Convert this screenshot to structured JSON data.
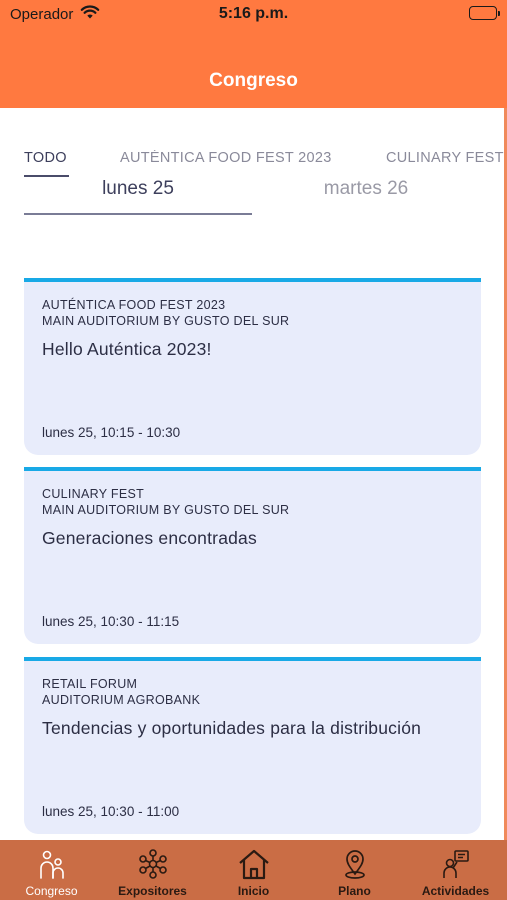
{
  "status_bar": {
    "carrier": "Operador",
    "time": "5:16 p.m."
  },
  "header": {
    "title": "Congreso"
  },
  "category_tabs": [
    {
      "label": "TODO"
    },
    {
      "label": "AUTÉNTICA FOOD FEST 2023"
    },
    {
      "label": "CULINARY FEST"
    }
  ],
  "day_tabs": [
    {
      "label": "lunes 25"
    },
    {
      "label": "martes 26"
    }
  ],
  "sessions": [
    {
      "event": "AUTÉNTICA FOOD FEST 2023",
      "venue": "MAIN AUDITORIUM BY GUSTO DEL SUR",
      "title": "Hello Auténtica 2023!",
      "time": "lunes 25, 10:15 - 10:30"
    },
    {
      "event": "CULINARY FEST",
      "venue": "MAIN AUDITORIUM BY GUSTO DEL SUR",
      "title": "Generaciones encontradas",
      "time": "lunes 25, 10:30 - 11:15"
    },
    {
      "event": "RETAIL FORUM",
      "venue": "AUDITORIUM AGROBANK",
      "title": "Tendencias y oportunidades para la distribución",
      "time": "lunes 25, 10:30 - 11:00"
    }
  ],
  "bottom_nav": [
    {
      "label": "Congreso",
      "icon": "people-icon"
    },
    {
      "label": "Expositores",
      "icon": "network-icon"
    },
    {
      "label": "Inicio",
      "icon": "home-icon"
    },
    {
      "label": "Plano",
      "icon": "map-pin-icon"
    },
    {
      "label": "Actividades",
      "icon": "person-board-icon"
    }
  ],
  "colors": {
    "header": "#FF7940",
    "nav": "#CA6D45",
    "card": "#E8ECFB",
    "card_accent": "#18A9E6"
  }
}
